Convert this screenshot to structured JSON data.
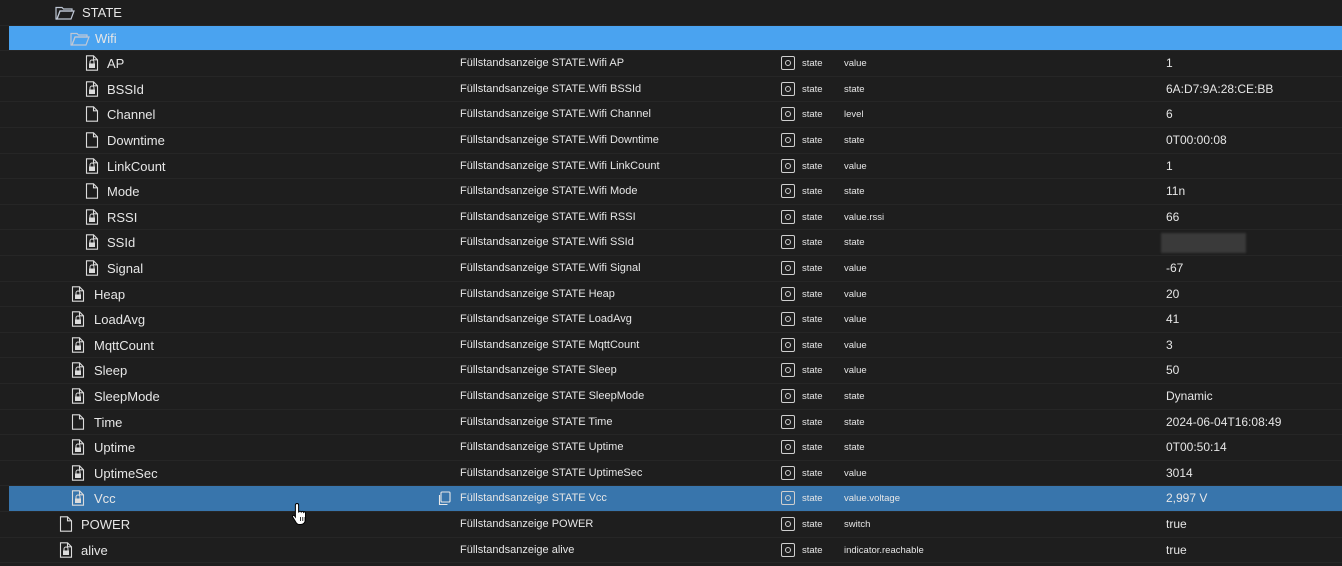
{
  "rows": [
    {
      "level": 0,
      "kind": "folder-open",
      "name": "STATE",
      "desc": "",
      "type": "",
      "role": "",
      "value": "",
      "selected": ""
    },
    {
      "level": 1,
      "kind": "folder-open",
      "name": "Wifi",
      "desc": "",
      "type": "",
      "role": "",
      "value": "",
      "selected": "light"
    },
    {
      "level": 2,
      "kind": "file-lock",
      "name": "AP",
      "desc": "Füllstandsanzeige STATE.Wifi AP",
      "type": "state",
      "role": "value",
      "value": "1",
      "selected": ""
    },
    {
      "level": 2,
      "kind": "file-lock",
      "name": "BSSId",
      "desc": "Füllstandsanzeige STATE.Wifi BSSId",
      "type": "state",
      "role": "state",
      "value": "6A:D7:9A:28:CE:BB",
      "selected": ""
    },
    {
      "level": 2,
      "kind": "file",
      "name": "Channel",
      "desc": "Füllstandsanzeige STATE.Wifi Channel",
      "type": "state",
      "role": "level",
      "value": "6",
      "selected": ""
    },
    {
      "level": 2,
      "kind": "file",
      "name": "Downtime",
      "desc": "Füllstandsanzeige STATE.Wifi Downtime",
      "type": "state",
      "role": "state",
      "value": "0T00:00:08",
      "selected": ""
    },
    {
      "level": 2,
      "kind": "file-lock",
      "name": "LinkCount",
      "desc": "Füllstandsanzeige STATE.Wifi LinkCount",
      "type": "state",
      "role": "value",
      "value": "1",
      "selected": ""
    },
    {
      "level": 2,
      "kind": "file",
      "name": "Mode",
      "desc": "Füllstandsanzeige STATE.Wifi Mode",
      "type": "state",
      "role": "state",
      "value": "11n",
      "selected": ""
    },
    {
      "level": 2,
      "kind": "file-lock",
      "name": "RSSI",
      "desc": "Füllstandsanzeige STATE.Wifi RSSI",
      "type": "state",
      "role": "value.rssi",
      "value": "66",
      "selected": ""
    },
    {
      "level": 2,
      "kind": "file-lock",
      "name": "SSId",
      "desc": "Füllstandsanzeige STATE.Wifi SSId",
      "type": "state",
      "role": "state",
      "value": "",
      "blurred": true,
      "selected": ""
    },
    {
      "level": 2,
      "kind": "file-lock",
      "name": "Signal",
      "desc": "Füllstandsanzeige STATE.Wifi Signal",
      "type": "state",
      "role": "value",
      "value": "-67",
      "selected": ""
    },
    {
      "level": 1,
      "kind": "file-lock",
      "name": "Heap",
      "desc": "Füllstandsanzeige STATE Heap",
      "type": "state",
      "role": "value",
      "value": "20",
      "selected": ""
    },
    {
      "level": 1,
      "kind": "file-lock",
      "name": "LoadAvg",
      "desc": "Füllstandsanzeige STATE LoadAvg",
      "type": "state",
      "role": "value",
      "value": "41",
      "selected": ""
    },
    {
      "level": 1,
      "kind": "file-lock",
      "name": "MqttCount",
      "desc": "Füllstandsanzeige STATE MqttCount",
      "type": "state",
      "role": "value",
      "value": "3",
      "selected": ""
    },
    {
      "level": 1,
      "kind": "file-lock",
      "name": "Sleep",
      "desc": "Füllstandsanzeige STATE Sleep",
      "type": "state",
      "role": "value",
      "value": "50",
      "selected": ""
    },
    {
      "level": 1,
      "kind": "file-lock",
      "name": "SleepMode",
      "desc": "Füllstandsanzeige STATE SleepMode",
      "type": "state",
      "role": "state",
      "value": "Dynamic",
      "selected": ""
    },
    {
      "level": 1,
      "kind": "file",
      "name": "Time",
      "desc": "Füllstandsanzeige STATE Time",
      "type": "state",
      "role": "state",
      "value": "2024-06-04T16:08:49",
      "selected": ""
    },
    {
      "level": 1,
      "kind": "file-lock",
      "name": "Uptime",
      "desc": "Füllstandsanzeige STATE Uptime",
      "type": "state",
      "role": "state",
      "value": "0T00:50:14",
      "selected": ""
    },
    {
      "level": 1,
      "kind": "file-lock",
      "name": "UptimeSec",
      "desc": "Füllstandsanzeige STATE UptimeSec",
      "type": "state",
      "role": "value",
      "value": "3014",
      "selected": ""
    },
    {
      "level": 1,
      "kind": "file-lock",
      "name": "Vcc",
      "desc": "Füllstandsanzeige STATE Vcc",
      "type": "state",
      "role": "value.voltage",
      "value": "2,997 V",
      "selected": "dark",
      "copy": true
    },
    {
      "level": 0,
      "kind": "file",
      "name": "POWER",
      "desc": "Füllstandsanzeige POWER",
      "type": "state",
      "role": "switch",
      "value": "true",
      "selected": ""
    },
    {
      "level": 0,
      "kind": "file-lock",
      "name": "alive",
      "desc": "Füllstandsanzeige alive",
      "type": "state",
      "role": "indicator.reachable",
      "value": "true",
      "selected": ""
    }
  ],
  "icons": {
    "folder_open": "folder-open-icon",
    "file": "file-icon",
    "file_lock": "file-lock-icon",
    "role": "state-role-icon",
    "copy": "copy-icon",
    "cursor": "hand-cursor-icon"
  },
  "colors": {
    "background": "#1e1e1e",
    "selected_light": "#4aa3f0",
    "selected_dark": "#3875ac",
    "text": "#e6e6e6"
  }
}
